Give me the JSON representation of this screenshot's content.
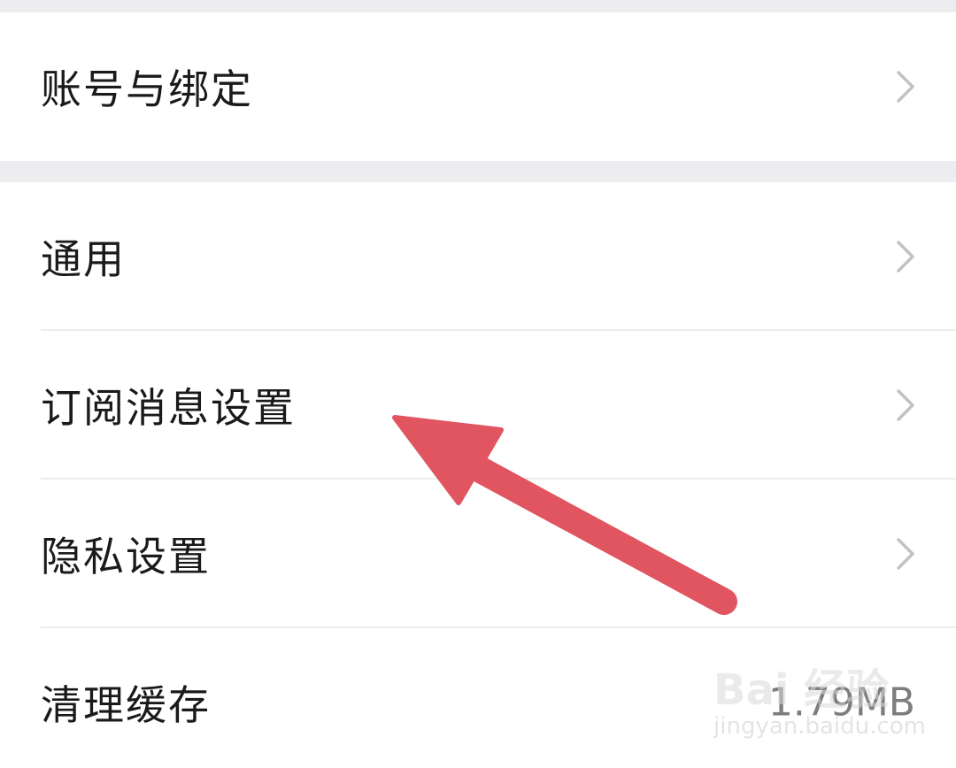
{
  "settings": {
    "account_group": [
      {
        "label": "账号与绑定"
      }
    ],
    "main_group": [
      {
        "label": "通用"
      },
      {
        "label": "订阅消息设置"
      },
      {
        "label": "隐私设置"
      },
      {
        "label": "清理缓存",
        "value": "1.79MB"
      }
    ]
  },
  "icons": {
    "chevron": "chevron-right-icon",
    "annotation": "arrow-annotation"
  },
  "colors": {
    "background": "#ededef",
    "row": "#ffffff",
    "text": "#1a1a1a",
    "chevron": "#c2c2c2",
    "annotation_arrow": "#e05560"
  },
  "watermark": {
    "brand": "Bai 经验",
    "url": "jingyan.baidu.com"
  }
}
